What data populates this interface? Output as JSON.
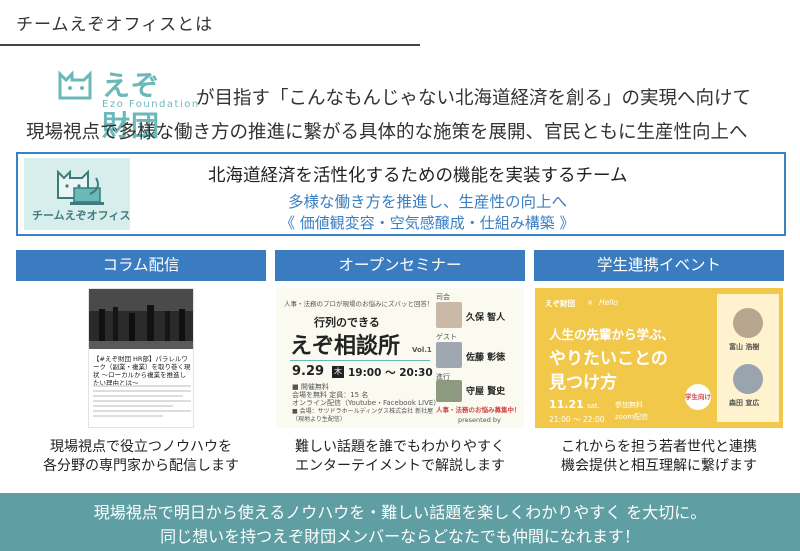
{
  "header": {
    "title": "チームえぞオフィスとは"
  },
  "logo": {
    "text": "えぞ財団",
    "sub": "Ezo Foundation"
  },
  "intro": {
    "line1": "が目指す「こんなもんじゃない北海道経済を創る」の実現へ向けて",
    "line2": "現場視点で多様な働き方の推進に繋がる具体的な施策を展開、官民ともに生産性向上へ"
  },
  "team": {
    "logo_label": "チームえぞオフィス",
    "title": "北海道経済を活性化するための機能を実装するチーム",
    "subtitle": "多様な働き方を推進し、生産性の向上へ",
    "pillars": "《 価値観変容・空気感醸成・仕組み構築 》"
  },
  "columns": [
    {
      "heading": "コラム配信",
      "image_caption": "【#えぞ財団 HR部】パラレルワーク（副業・複業）を取り巻く現状 〜ローカルから複業を推進したい理由とは〜",
      "desc_line1": "現場視点で役立つノウハウを",
      "desc_line2": "各分野の専門家から配信します"
    },
    {
      "heading": "オープンセミナー",
      "image": {
        "tagline": "人事・法務のプロが現場のお悩みにズバッと回答！",
        "title_small": "行列のできる",
        "title_big": "えぞ相談所",
        "vol": "Vol.1",
        "date": "9.29",
        "weekday": "木",
        "time": "19:00 〜 20:30",
        "detail1": "■ 開催無料",
        "detail2": "会場を無料 定員：15 名",
        "detail3": "オンライン配信（Youtube・Facebook LIVE）",
        "detail4": "■ 会場：サツドラホールディングス株式会社 新社屋",
        "detail5": "（現地より生配信）",
        "speaker1_name": "久保 智人",
        "speaker2_name": "佐藤 彰徳",
        "speaker3_name": "守屋 賢史",
        "speaker_role_host": "司会",
        "speaker_role_guest": "ゲスト",
        "speaker_role_mc": "進行",
        "notice": "人事・法務のお悩み募集中！",
        "presented": "presented by"
      },
      "desc_line1": "難しい話題を誰でもわかりやすく",
      "desc_line2": "エンターテイメントで解説します"
    },
    {
      "heading": "学生連携イベント",
      "image": {
        "brand": "えぞ財団",
        "partner": "Hello",
        "line1": "人生の先輩から学ぶ、",
        "line2": "やりたいことの",
        "line3": "見つけ方",
        "date": "11.21",
        "weekday": "sat.",
        "time": "21:00 〜 22:00",
        "fee": "参加無料",
        "venue": "zoom配信",
        "badge": "学生向け",
        "speaker1": "富山 浩樹",
        "speaker2": "森田 宣広"
      },
      "desc_line1": "これからを担う若者世代と連携",
      "desc_line2": "機会提供と相互理解に繋げます"
    }
  ],
  "footer": {
    "line1": "現場視点で明日から使えるノウハウを・難しい話題を楽しくわかりやすく を大切に。",
    "line2": "同じ想いを持つえぞ財団メンバーならどなたでも仲間になれます！"
  },
  "colors": {
    "teal": "#5f9ea3",
    "blue": "#3b7cc0",
    "logo_teal": "#6bb8b9",
    "yellow": "#f2c84b"
  }
}
